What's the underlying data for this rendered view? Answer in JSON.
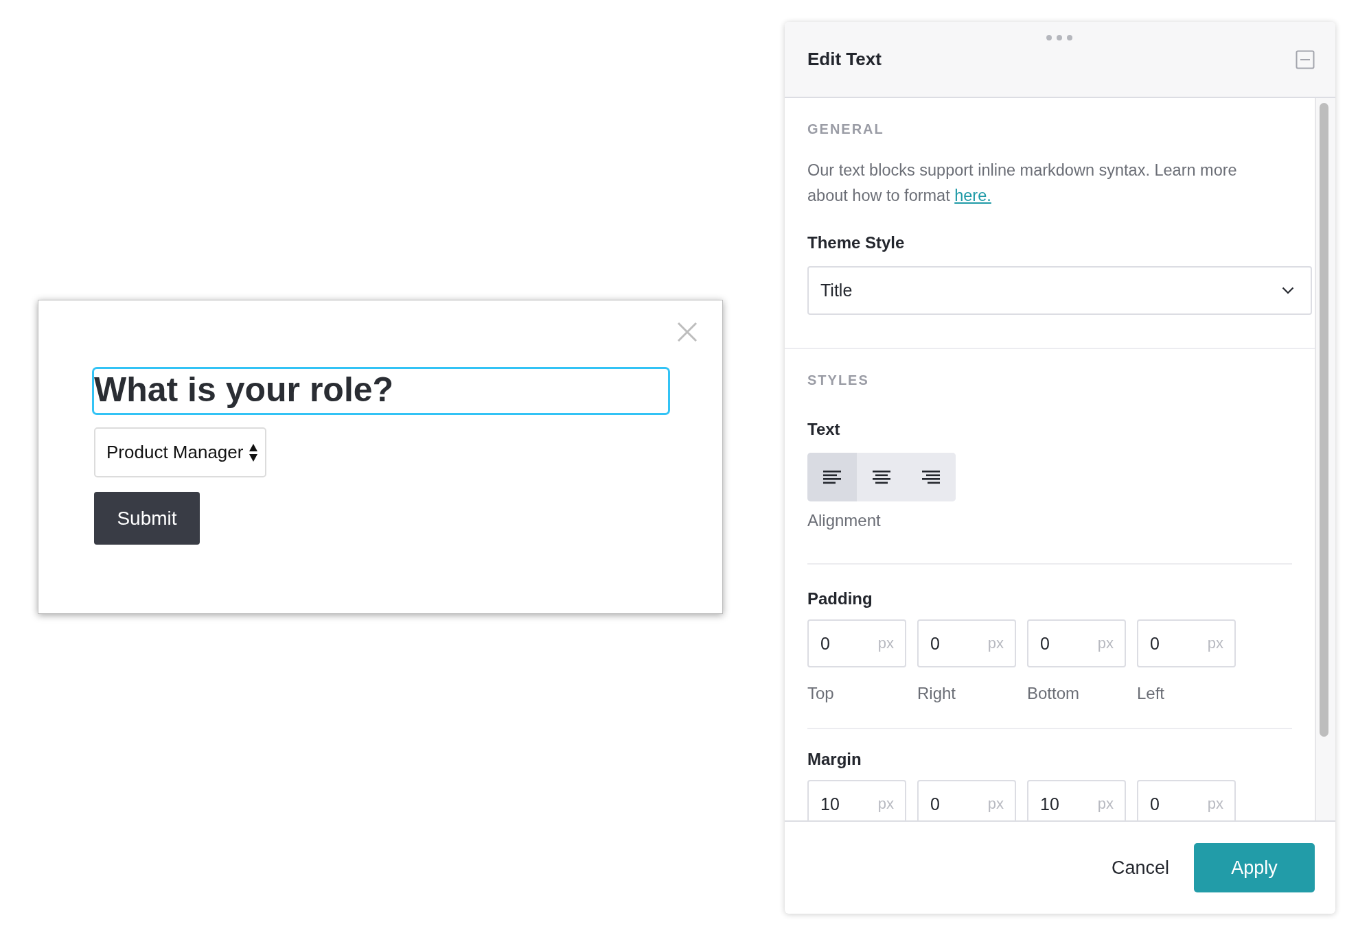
{
  "dialog": {
    "heading": "What is your role?",
    "heading_focused": true,
    "role_select": {
      "value": "Product Manager"
    },
    "submit": "Submit"
  },
  "panel": {
    "title": "Edit Text",
    "general": {
      "label": "GENERAL",
      "help": "Our text blocks support inline markdown syntax. Learn more about how to format",
      "help_link": "here.",
      "theme_label": "Theme Style",
      "theme_value": "Title"
    },
    "styles": {
      "label": "STYLES",
      "text_label": "Text",
      "alignment_label": "Alignment",
      "alignment": [
        {
          "kind": "left",
          "selected": true
        },
        {
          "kind": "center",
          "selected": false
        },
        {
          "kind": "right",
          "selected": false
        }
      ],
      "padding_label": "Padding",
      "padding": [
        {
          "value": "0",
          "unit": "px",
          "label": "Top"
        },
        {
          "value": "0",
          "unit": "px",
          "label": "Right"
        },
        {
          "value": "0",
          "unit": "px",
          "label": "Bottom"
        },
        {
          "value": "0",
          "unit": "px",
          "label": "Left"
        }
      ],
      "margin_label": "Margin",
      "margin": [
        {
          "value": "10",
          "unit": "px"
        },
        {
          "value": "0",
          "unit": "px"
        },
        {
          "value": "10",
          "unit": "px"
        },
        {
          "value": "0",
          "unit": "px"
        }
      ]
    },
    "footer": {
      "cancel": "Cancel",
      "apply": "Apply"
    }
  }
}
